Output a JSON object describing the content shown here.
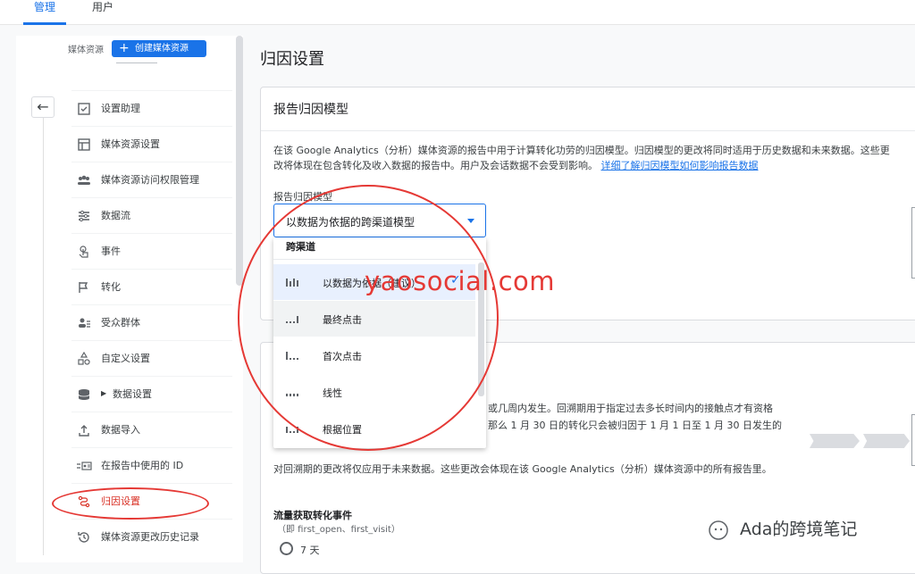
{
  "tabs": [
    {
      "label": "管理",
      "active": true
    },
    {
      "label": "用户",
      "active": false
    }
  ],
  "property": {
    "label": "媒体资源",
    "create_button": "创建媒体资源"
  },
  "nav": {
    "items": [
      {
        "label": "设置助理",
        "icon": "checklist-icon"
      },
      {
        "label": "媒体资源设置",
        "icon": "layout-icon"
      },
      {
        "label": "媒体资源访问权限管理",
        "icon": "people-icon"
      },
      {
        "label": "数据流",
        "icon": "streams-icon"
      },
      {
        "label": "事件",
        "icon": "touch-icon"
      },
      {
        "label": "转化",
        "icon": "flag-icon"
      },
      {
        "label": "受众群体",
        "icon": "audience-icon"
      },
      {
        "label": "自定义设置",
        "icon": "shapes-icon"
      },
      {
        "label": "数据设置",
        "icon": "database-icon"
      },
      {
        "label": "数据导入",
        "icon": "upload-icon"
      },
      {
        "label": "在报告中使用的 ID",
        "icon": "id-icon"
      },
      {
        "label": "归因设置",
        "icon": "attribution-icon",
        "active": true
      },
      {
        "label": "媒体资源更改历史记录",
        "icon": "history-icon"
      }
    ]
  },
  "main": {
    "page_title": "归因设置",
    "card_title": "报告归因模型",
    "description": "在该 Google Analytics（分析）媒体资源的报告中用于计算转化功劳的归因模型。归因模型的更改将同时适用于历史数据和未来数据。这些更改将体现在包含转化及收入数据的报告中。用户及会话数据不会受到影响。",
    "description_link": "详细了解归因模型如何影响报告数据",
    "field_label": "报告归因模型",
    "selected_value": "以数据为依据的跨渠道模型",
    "lookback_text_1": "或几周内发生。回溯期用于指定过去多长时间内的接触点才有资格",
    "lookback_text_2": "那么 1 月 30 日的转化只会被归因于 1 月 1 日至 1 月 30 日发生的",
    "lookback_note": "对回溯期的更改将仅应用于未来数据。这些更改会体现在该 Google Analytics（分析）媒体资源中的所有报告里。",
    "traffic_label": "流量获取转化事件",
    "traffic_sub": "（即 first_open、first_visit）",
    "radio_label": "7 天"
  },
  "dropdown": {
    "header": "跨渠道",
    "items": [
      {
        "label": "以数据为依据（建议）",
        "selected": true
      },
      {
        "label": "最终点击"
      },
      {
        "label": "首次点击"
      },
      {
        "label": "线性"
      },
      {
        "label": "根据位置"
      }
    ]
  },
  "watermarks": {
    "site": "yaosocial.com",
    "author": "Ada的跨境笔记"
  },
  "colors": {
    "accent": "#1a73e8",
    "annotation": "#e53935"
  }
}
